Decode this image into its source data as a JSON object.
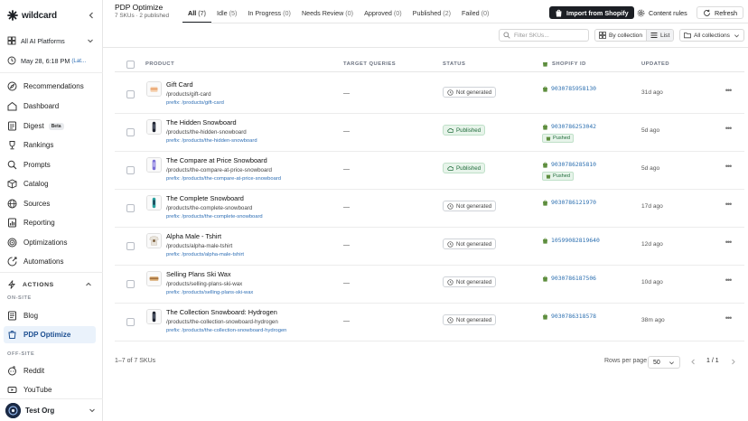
{
  "sidebar": {
    "brand": "wildcard",
    "platforms": "All AI Platforms",
    "date": "May 28, 6:18 PM",
    "date_suffix": "(Lat...",
    "nav": [
      {
        "label": "Recommendations",
        "icon": "compass-icon"
      },
      {
        "label": "Dashboard",
        "icon": "dashboard-icon"
      },
      {
        "label": "Digest",
        "icon": "digest-icon",
        "badge": "Beta"
      },
      {
        "label": "Rankings",
        "icon": "rankings-icon"
      },
      {
        "label": "Prompts",
        "icon": "search-icon"
      },
      {
        "label": "Catalog",
        "icon": "catalog-icon"
      },
      {
        "label": "Sources",
        "icon": "sources-icon"
      },
      {
        "label": "Reporting",
        "icon": "reporting-icon"
      },
      {
        "label": "Optimizations",
        "icon": "optimizations-icon"
      },
      {
        "label": "Automations",
        "icon": "automations-icon"
      }
    ],
    "actions_label": "ACTIONS",
    "on_site_label": "ON-SITE",
    "on_site": [
      {
        "label": "Blog",
        "icon": "blog-icon"
      },
      {
        "label": "PDP Optimize",
        "icon": "pdp-icon",
        "active": true
      }
    ],
    "off_site_label": "OFF-SITE",
    "off_site": [
      {
        "label": "Reddit",
        "icon": "reddit-icon"
      },
      {
        "label": "YouTube",
        "icon": "youtube-icon"
      }
    ],
    "org": "Test Org"
  },
  "header": {
    "title": "PDP Optimize",
    "subtitle": "7 SKUs · 2 published",
    "tabs": [
      {
        "label": "All",
        "count": "(7)",
        "active": true
      },
      {
        "label": "Idle",
        "count": "(5)"
      },
      {
        "label": "In Progress",
        "count": "(0)"
      },
      {
        "label": "Needs Review",
        "count": "(0)"
      },
      {
        "label": "Approved",
        "count": "(0)"
      },
      {
        "label": "Published",
        "count": "(2)"
      },
      {
        "label": "Failed",
        "count": "(0)"
      }
    ],
    "import_label": "Import from Shopify",
    "content_rules_label": "Content rules",
    "refresh_label": "Refresh"
  },
  "toolbar": {
    "search_placeholder": "Filter SKUs...",
    "by_collection": "By collection",
    "list": "List",
    "collections": "All collections"
  },
  "table": {
    "columns": [
      "PRODUCT",
      "TARGET QUERIES",
      "STATUS",
      "SHOPIFY ID",
      "UPDATED"
    ],
    "rows": [
      {
        "name": "Gift Card",
        "path": "/products/gift-card",
        "prefix": "prefix: /products/gift-card",
        "queries": "—",
        "status": "Not generated",
        "shopify_id": "9030785958130",
        "pushed": "",
        "updated": "31d ago",
        "thumb": "giftcard"
      },
      {
        "name": "The Hidden Snowboard",
        "path": "/products/the-hidden-snowboard",
        "prefix": "prefix: /products/the-hidden-snowboard",
        "queries": "—",
        "status": "Published",
        "shopify_id": "9030786253042",
        "pushed": "Pushed",
        "updated": "5d ago",
        "thumb": "board-dark"
      },
      {
        "name": "The Compare at Price Snowboard",
        "path": "/products/the-compare-at-price-snowboard",
        "prefix": "prefix: /products/the-compare-at-price-snowboard",
        "queries": "—",
        "status": "Published",
        "shopify_id": "9030786285810",
        "pushed": "Pushed",
        "updated": "5d ago",
        "thumb": "board-purple"
      },
      {
        "name": "The Complete Snowboard",
        "path": "/products/the-complete-snowboard",
        "prefix": "prefix: /products/the-complete-snowboard",
        "queries": "—",
        "status": "Not generated",
        "shopify_id": "9030786121970",
        "pushed": "",
        "updated": "17d ago",
        "thumb": "board-teal"
      },
      {
        "name": "Alpha Male - Tshirt",
        "path": "/products/alpha-male-tshirt",
        "prefix": "prefix: /products/alpha-male-tshirt",
        "queries": "—",
        "status": "Not generated",
        "shopify_id": "10599082819640",
        "pushed": "",
        "updated": "12d ago",
        "thumb": "tshirt"
      },
      {
        "name": "Selling Plans Ski Wax",
        "path": "/products/selling-plans-ski-wax",
        "prefix": "prefix: /products/selling-plans-ski-wax",
        "queries": "—",
        "status": "Not generated",
        "shopify_id": "9030786187506",
        "pushed": "",
        "updated": "10d ago",
        "thumb": "wax"
      },
      {
        "name": "The Collection Snowboard: Hydrogen",
        "path": "/products/the-collection-snowboard-hydrogen",
        "prefix": "prefix: /products/the-collection-snowboard-hydrogen",
        "queries": "—",
        "status": "Not generated",
        "shopify_id": "9030786318578",
        "pushed": "",
        "updated": "38m ago",
        "thumb": "board-dark"
      }
    ]
  },
  "footer": {
    "range": "1–7 of 7 SKUs",
    "rows_per_page_label": "Rows per page",
    "rows_per_page": "50",
    "page": "1 / 1"
  },
  "colors": {
    "accent": "#1d4f91",
    "published_bg": "#e7f4ea",
    "shopify_green": "#5e8e3e",
    "link": "#2f6fb5"
  }
}
